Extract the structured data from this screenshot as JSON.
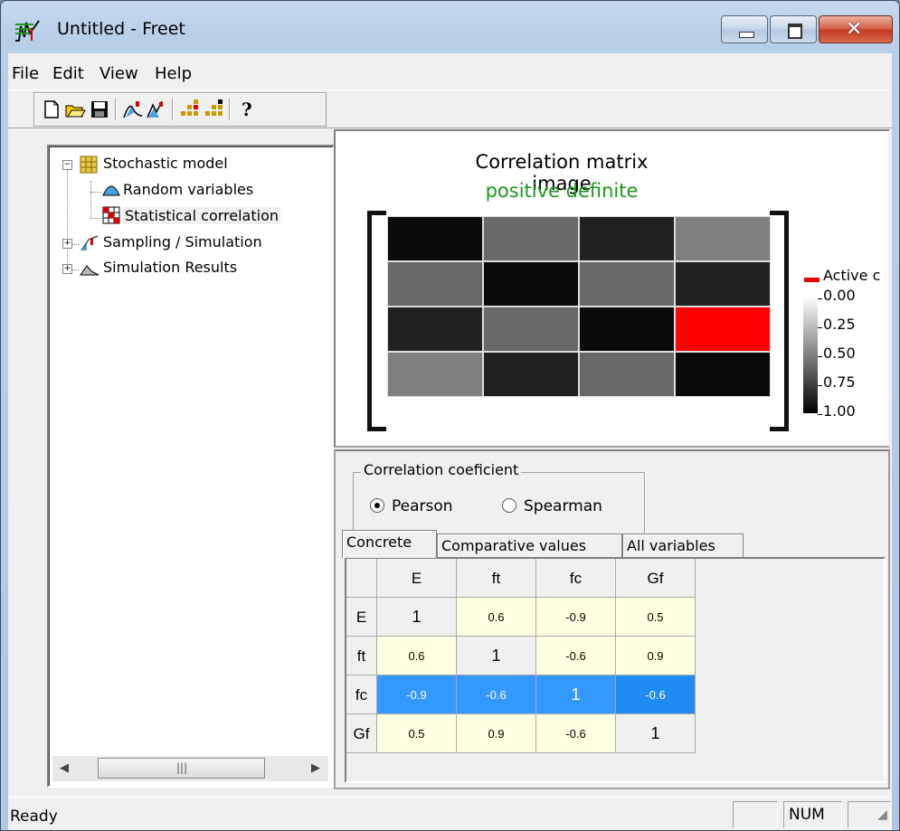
{
  "window": {
    "title": "Untitled - Freet"
  },
  "menu": [
    "File",
    "Edit",
    "View",
    "Help"
  ],
  "tree": {
    "root": "Stochastic model",
    "children": [
      "Random variables",
      "Statistical correlation"
    ],
    "siblings": [
      "Sampling / Simulation",
      "Simulation Results"
    ]
  },
  "chart": {
    "title": "Correlation matrix image",
    "subtitle": "positive definite",
    "active_label": "Active c",
    "active_color": "#ff0000",
    "ticks": [
      "0.00",
      "0.25",
      "0.50",
      "0.75",
      "1.00"
    ]
  },
  "chart_data": {
    "type": "heatmap",
    "title": "Correlation matrix image",
    "subtitle": "positive definite",
    "rows": [
      "E",
      "ft",
      "fc",
      "Gf"
    ],
    "cols": [
      "E",
      "ft",
      "fc",
      "Gf"
    ],
    "abs_values": [
      [
        1,
        0.6,
        0.9,
        0.5
      ],
      [
        0.6,
        1,
        0.6,
        0.9
      ],
      [
        0.9,
        0.6,
        1,
        0.6
      ],
      [
        0.5,
        0.9,
        0.6,
        1
      ]
    ],
    "active_cell": {
      "row": "fc",
      "col": "Gf"
    },
    "colorbar_range": [
      0.0,
      1.0
    ]
  },
  "corr_box": {
    "label": "Correlation coeficient",
    "options": [
      "Pearson",
      "Spearman"
    ],
    "selected": "Pearson"
  },
  "tabs": [
    "Concrete",
    "Comparative values",
    "All variables"
  ],
  "table": {
    "headers": [
      "E",
      "ft",
      "fc",
      "Gf"
    ],
    "rows": [
      {
        "name": "E",
        "values": [
          "1",
          "0.6",
          "-0.9",
          "0.5"
        ]
      },
      {
        "name": "ft",
        "values": [
          "0.6",
          "1",
          "-0.6",
          "0.9"
        ]
      },
      {
        "name": "fc",
        "values": [
          "-0.9",
          "-0.6",
          "1",
          "-0.6"
        ]
      },
      {
        "name": "Gf",
        "values": [
          "0.5",
          "0.9",
          "-0.6",
          "1"
        ]
      }
    ],
    "selected_row": 2,
    "colors": {
      "offdiag": "#ffffe1",
      "diag": "#f0f0f0",
      "selected": "#3399ff",
      "selected_focus": "#1e8cf0"
    }
  },
  "status": {
    "text": "Ready",
    "num": "NUM"
  }
}
